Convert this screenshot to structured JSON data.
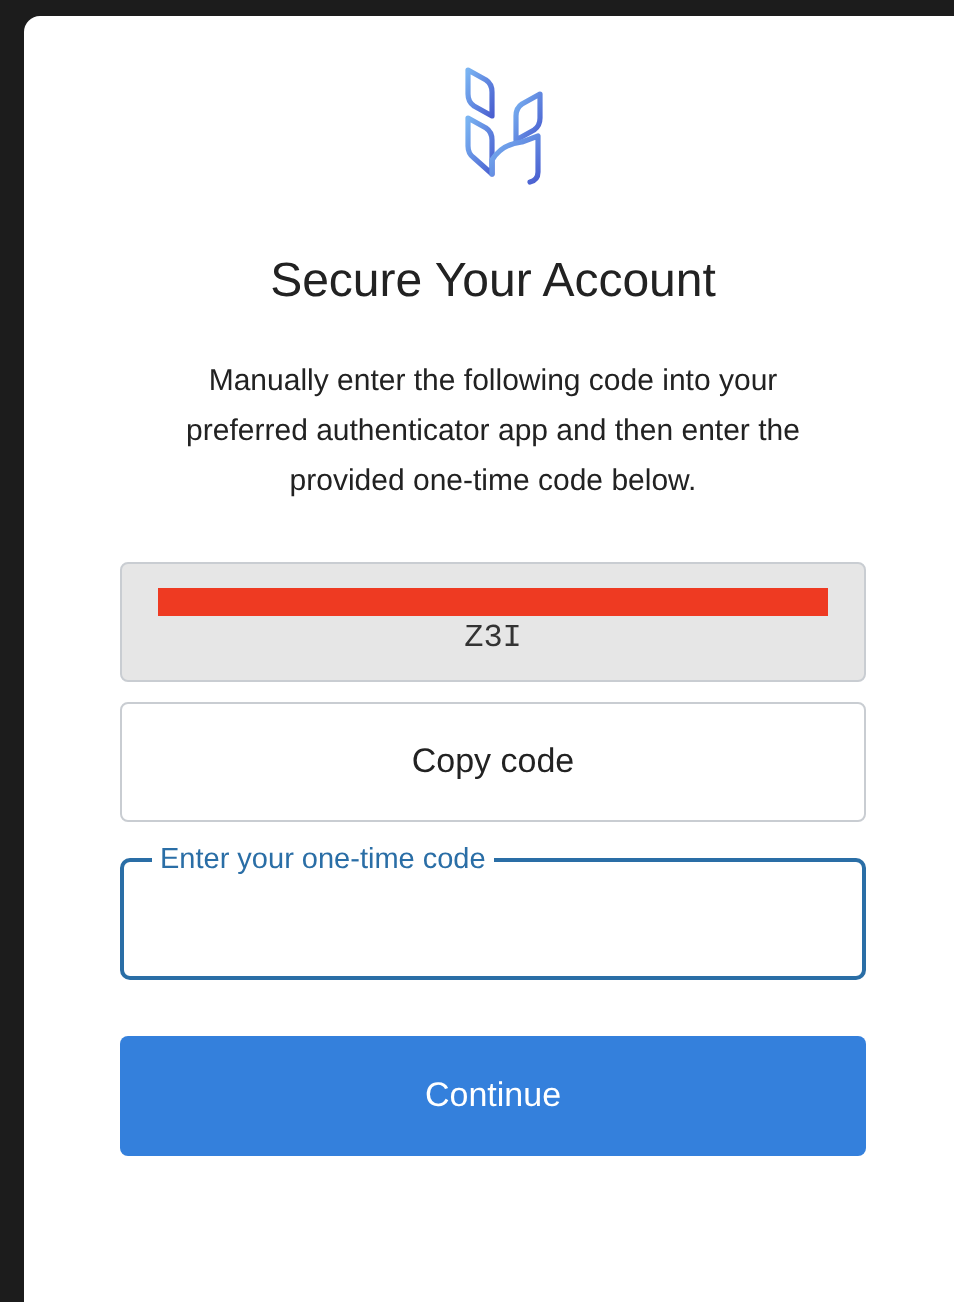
{
  "title": "Secure Your Account",
  "instructions": "Manually enter the following code into your preferred authenticator app and then enter the provided one-time code below.",
  "secret_code": {
    "redacted": true,
    "visible_text": "Z3I"
  },
  "copy_button": "Copy code",
  "otp_field": {
    "label": "Enter your one-time code",
    "focused": true
  },
  "continue_button": "Continue"
}
